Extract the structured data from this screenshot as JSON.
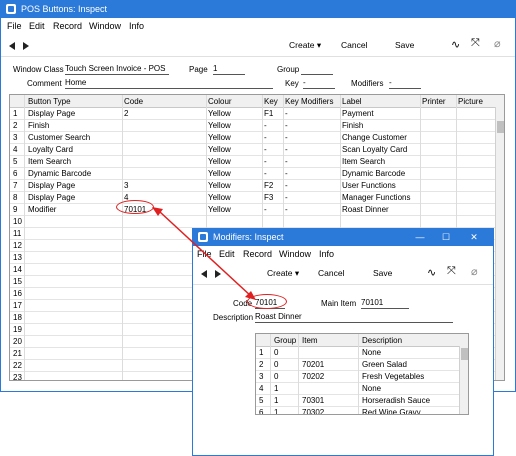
{
  "main": {
    "title": "POS Buttons: Inspect",
    "menu": [
      "File",
      "Edit",
      "Record",
      "Window",
      "Info"
    ],
    "toolbar": {
      "create": "Create",
      "cancel": "Cancel",
      "save": "Save"
    },
    "form": {
      "window_class_label": "Window Class",
      "window_class_value": "Touch Screen Invoice - POS",
      "page_label": "Page",
      "page_value": "1",
      "group_label": "Group",
      "group_value": "",
      "comment_label": "Comment",
      "comment_value": "Home",
      "key_label": "Key",
      "key_value": "-",
      "modifiers_label": "Modifiers",
      "modifiers_value": "-"
    },
    "columns": [
      "Button Type",
      "Code",
      "Colour",
      "Key",
      "Key Modifiers",
      "Label",
      "Printer",
      "Picture"
    ],
    "rows": [
      {
        "n": "1",
        "type": "Display Page",
        "code": "2",
        "colour": "Yellow",
        "key": "F1",
        "mod": "-",
        "label": "Payment"
      },
      {
        "n": "2",
        "type": "Finish",
        "code": "",
        "colour": "Yellow",
        "key": "-",
        "mod": "-",
        "label": "Finish"
      },
      {
        "n": "3",
        "type": "Customer Search",
        "code": "",
        "colour": "Yellow",
        "key": "-",
        "mod": "-",
        "label": "Change Customer"
      },
      {
        "n": "4",
        "type": "Loyalty Card",
        "code": "",
        "colour": "Yellow",
        "key": "-",
        "mod": "-",
        "label": "Scan Loyalty Card"
      },
      {
        "n": "5",
        "type": "Item Search",
        "code": "",
        "colour": "Yellow",
        "key": "-",
        "mod": "-",
        "label": "Item Search"
      },
      {
        "n": "6",
        "type": "Dynamic Barcode",
        "code": "",
        "colour": "Yellow",
        "key": "-",
        "mod": "-",
        "label": "Dynamic Barcode"
      },
      {
        "n": "7",
        "type": "Display Page",
        "code": "3",
        "colour": "Yellow",
        "key": "F2",
        "mod": "-",
        "label": "User Functions"
      },
      {
        "n": "8",
        "type": "Display Page",
        "code": "4",
        "colour": "Yellow",
        "key": "F3",
        "mod": "-",
        "label": "Manager Functions"
      },
      {
        "n": "9",
        "type": "Modifier",
        "code": "70101",
        "colour": "Yellow",
        "key": "-",
        "mod": "-",
        "label": "Roast Dinner"
      },
      {
        "n": "10"
      },
      {
        "n": "11"
      },
      {
        "n": "12"
      },
      {
        "n": "13"
      },
      {
        "n": "14"
      },
      {
        "n": "15"
      },
      {
        "n": "16"
      },
      {
        "n": "17"
      },
      {
        "n": "18"
      },
      {
        "n": "19"
      },
      {
        "n": "20"
      },
      {
        "n": "21"
      },
      {
        "n": "22"
      },
      {
        "n": "23"
      }
    ]
  },
  "modifiers": {
    "title": "Modifiers: Inspect",
    "menu": [
      "File",
      "Edit",
      "Record",
      "Window",
      "Info"
    ],
    "toolbar": {
      "create": "Create",
      "cancel": "Cancel",
      "save": "Save"
    },
    "form": {
      "code_label": "Code",
      "code_value": "70101",
      "main_item_label": "Main Item",
      "main_item_value": "70101",
      "description_label": "Description",
      "description_value": "Roast Dinner"
    },
    "columns": [
      "Group",
      "Item",
      "Description"
    ],
    "rows": [
      {
        "n": "1",
        "group": "0",
        "item": "",
        "desc": "None"
      },
      {
        "n": "2",
        "group": "0",
        "item": "70201",
        "desc": "Green Salad"
      },
      {
        "n": "3",
        "group": "0",
        "item": "70202",
        "desc": "Fresh Vegetables"
      },
      {
        "n": "4",
        "group": "1",
        "item": "",
        "desc": "None"
      },
      {
        "n": "5",
        "group": "1",
        "item": "70301",
        "desc": "Horseradish Sauce"
      },
      {
        "n": "6",
        "group": "1",
        "item": "70302",
        "desc": "Red Wine Gravy"
      }
    ]
  },
  "colors": {
    "titlebar": "#2b79d8",
    "annotation": "#e02020"
  }
}
